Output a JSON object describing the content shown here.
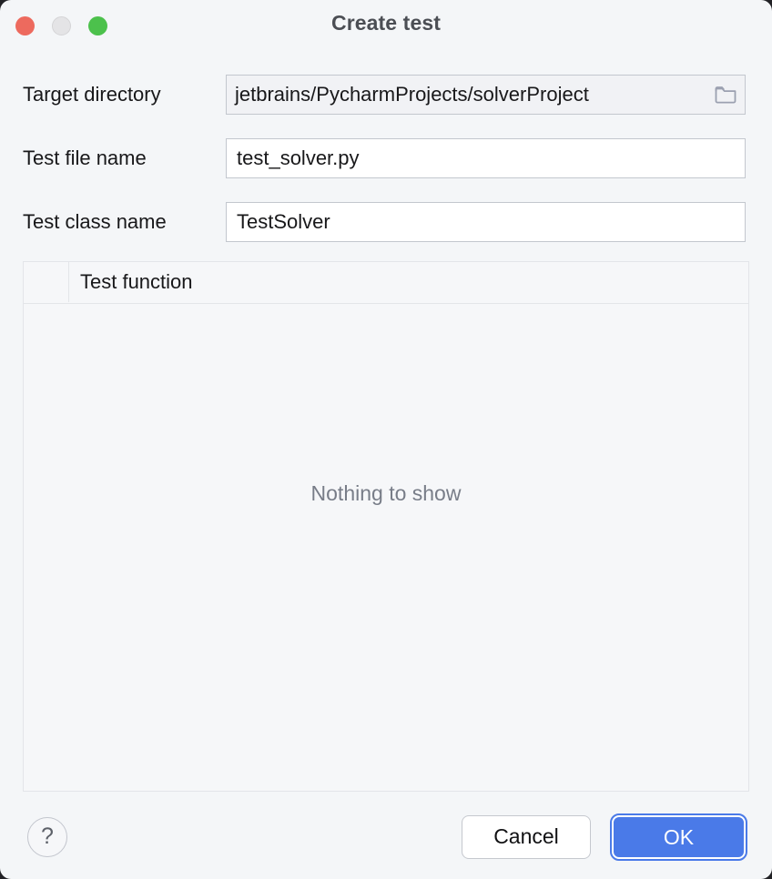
{
  "window": {
    "title": "Create test",
    "controls": {
      "close": "close-button",
      "minimize": "minimize-button",
      "maximize": "maximize-button"
    }
  },
  "form": {
    "rows": [
      {
        "label": "Target directory",
        "value": "jetbrains/PycharmProjects/solverProject",
        "icon": "folder-icon",
        "readonly": true
      },
      {
        "label": "Test file name",
        "value": "test_solver.py",
        "readonly": false
      },
      {
        "label": "Test class name",
        "value": "TestSolver",
        "readonly": false
      }
    ]
  },
  "table": {
    "columns": [
      {
        "header": ""
      },
      {
        "header": "Test function"
      }
    ],
    "rows": [],
    "empty_message": "Nothing to show"
  },
  "footer": {
    "help_label": "?",
    "cancel_label": "Cancel",
    "ok_label": "OK"
  },
  "colors": {
    "background": "#f4f6f8",
    "accent": "#4a7ae8",
    "title_text": "#4b4e54",
    "empty_text": "#787d88",
    "field_border": "#c3c7ce",
    "traffic_close": "#ed6a5e",
    "traffic_min": "#e4e4e6",
    "traffic_max": "#4cc14c"
  }
}
